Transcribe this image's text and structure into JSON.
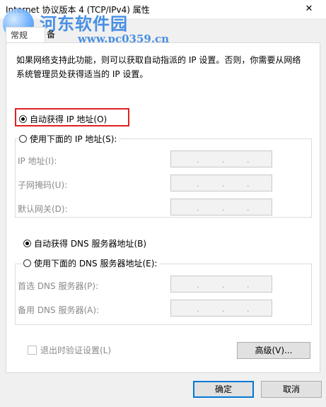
{
  "window": {
    "title": "Internet 协议版本 4 (TCP/IPv4) 属性",
    "close_glyph": "✕"
  },
  "watermark": {
    "text": "河东软件园",
    "url": "www.pc0359.cn"
  },
  "tabs": [
    {
      "label": "常规"
    },
    {
      "label": "备用配置"
    }
  ],
  "description": "如果网络支持此功能，则可以获取自动指派的 IP 设置。否则，你需要从网络系统管理员处获得适当的 IP 设置。",
  "ip_mode": {
    "auto_label": "自动获得 IP 地址(O)",
    "auto_selected": true,
    "manual_label": "使用下面的 IP 地址(S):",
    "manual_selected": false
  },
  "ip_fields": [
    {
      "label": "IP 地址(I):",
      "value": ". . ."
    },
    {
      "label": "子网掩码(U):",
      "value": ". . ."
    },
    {
      "label": "默认网关(D):",
      "value": ". . ."
    }
  ],
  "dns_mode": {
    "auto_label": "自动获得 DNS 服务器地址(B)",
    "auto_selected": true,
    "manual_label": "使用下面的 DNS 服务器地址(E):",
    "manual_selected": false
  },
  "dns_fields": [
    {
      "label": "首选 DNS 服务器(P):",
      "value": ". . ."
    },
    {
      "label": "备用 DNS 服务器(A):",
      "value": ". . ."
    }
  ],
  "validate_on_exit": {
    "label": "退出时验证设置(L)",
    "checked": false
  },
  "buttons": {
    "advanced": "高级(V)...",
    "ok": "确定",
    "cancel": "取消"
  },
  "colors": {
    "highlight": "#e02020",
    "watermark": "#2b7fe0",
    "ok_border": "#0078d7"
  }
}
